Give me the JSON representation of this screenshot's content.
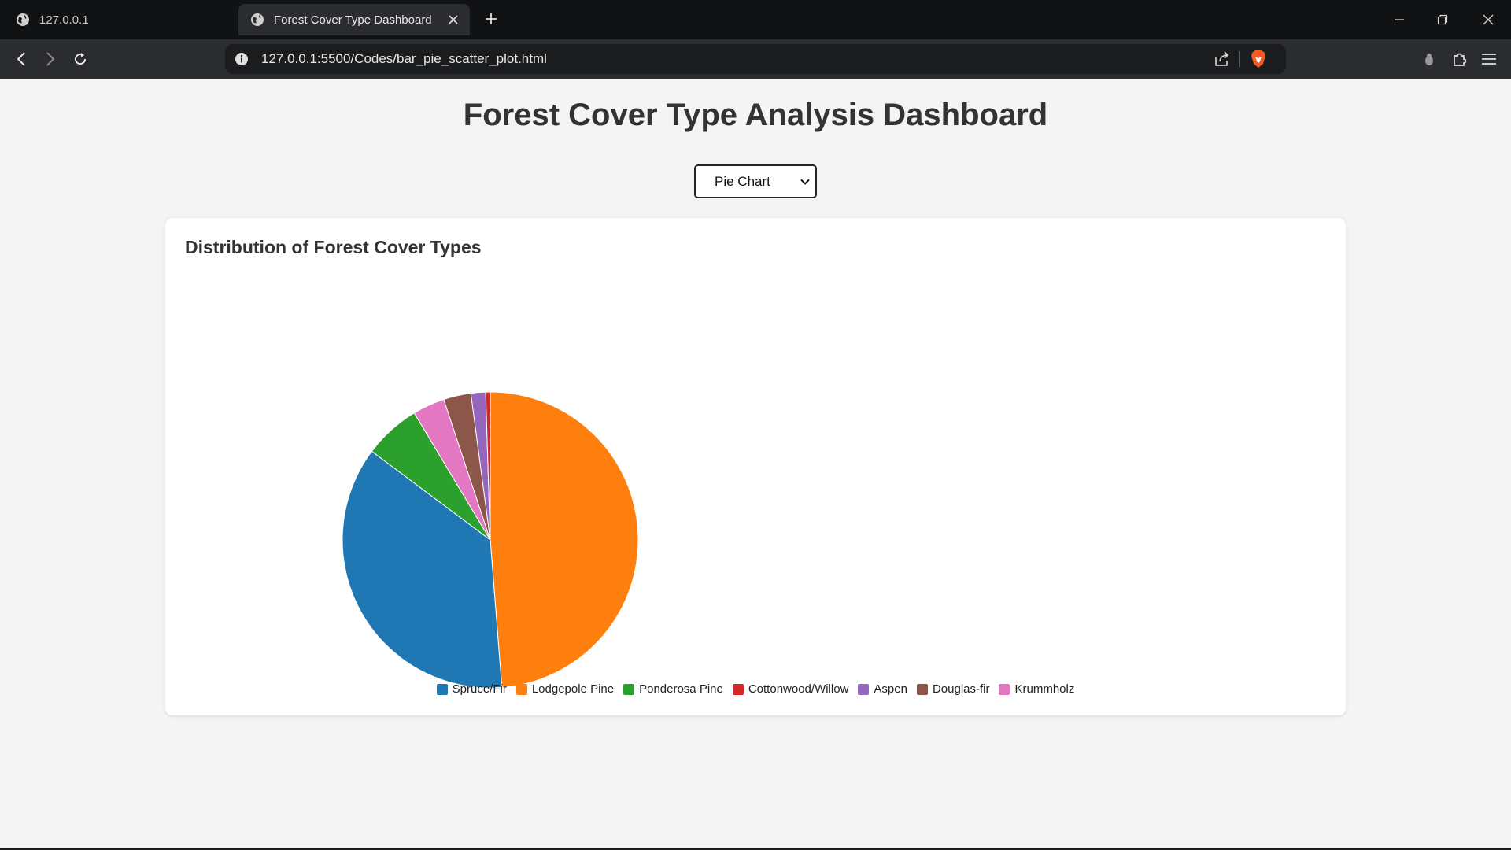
{
  "browser": {
    "tabs": [
      {
        "title": "127.0.0.1",
        "active": false
      },
      {
        "title": "Forest Cover Type Dashboard",
        "active": true
      }
    ],
    "url": "127.0.0.1:5500/Codes/bar_pie_scatter_plot.html"
  },
  "page": {
    "title": "Forest Cover Type Analysis Dashboard",
    "chart_selector": {
      "selected": "Pie Chart"
    },
    "card_title": "Distribution of Forest Cover Types"
  },
  "chart_data": {
    "type": "pie",
    "title": "Distribution of Forest Cover Types",
    "legend_placement": "bottom",
    "slices": [
      {
        "label": "Lodgepole Pine",
        "value": 48.8,
        "color": "#ff7f0e"
      },
      {
        "label": "Spruce/Fir",
        "value": 36.5,
        "color": "#1f77b4"
      },
      {
        "label": "Ponderosa Pine",
        "value": 6.2,
        "color": "#2ca02c"
      },
      {
        "label": "Krummholz",
        "value": 3.5,
        "color": "#e377c2"
      },
      {
        "label": "Douglas-fir",
        "value": 3.0,
        "color": "#8c564b"
      },
      {
        "label": "Aspen",
        "value": 1.6,
        "color": "#9467bd"
      },
      {
        "label": "Cottonwood/Willow",
        "value": 0.5,
        "color": "#d62728"
      }
    ],
    "legend": [
      {
        "label": "Spruce/Fir",
        "color": "#1f77b4"
      },
      {
        "label": "Lodgepole Pine",
        "color": "#ff7f0e"
      },
      {
        "label": "Ponderosa Pine",
        "color": "#2ca02c"
      },
      {
        "label": "Cottonwood/Willow",
        "color": "#d62728"
      },
      {
        "label": "Aspen",
        "color": "#9467bd"
      },
      {
        "label": "Douglas-fir",
        "color": "#8c564b"
      },
      {
        "label": "Krummholz",
        "color": "#e377c2"
      }
    ]
  }
}
